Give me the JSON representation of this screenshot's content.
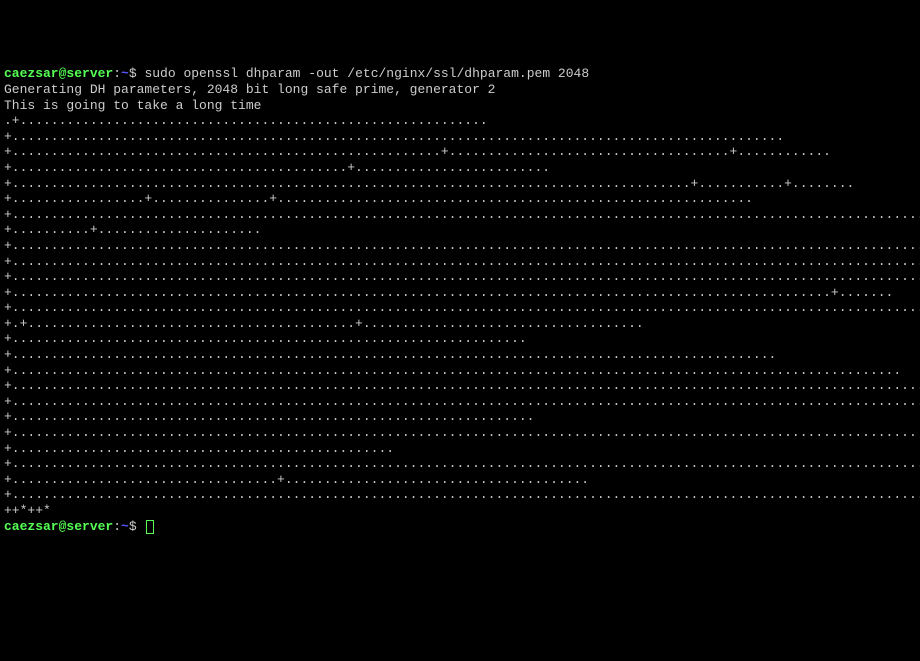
{
  "prompt1": {
    "user_host": "caezsar@server",
    "separator": ":",
    "path": "~",
    "symbol": "$ ",
    "command": "sudo openssl dhparam -out /etc/nginx/ssl/dhparam.pem 2048"
  },
  "output_line1": "Generating DH parameters, 2048 bit long safe prime, generator 2",
  "output_line2": "This is going to take a long time",
  "progress_dots": ".+............................................................+...................................................................................................+.......................................................+....................................+............+...........................................+.........................+.......................................................................................+...........+........+.................+...............+.............................................................+..........................................................................................................................................................................+..........+.....................+...........................................................................................................................................................................+...............................................................................................................................................................................................+............................................................................................................................+.........................................................................................................+.......+......................................................................................................................................+.+..........................................+....................................+..................................................................+..................................................................................................+..................................................................................................................+......................................................................................................................................................................................................................................................................................+...............................................................................................................................................................................................................................................................................+...................................................................+....................................................................................................................+.................................................+...........................................................................................................................................+..................................+.......................................+.....................................................................................................................++*++*",
  "prompt2": {
    "user_host": "caezsar@server",
    "separator": ":",
    "path": "~",
    "symbol": "$ "
  }
}
